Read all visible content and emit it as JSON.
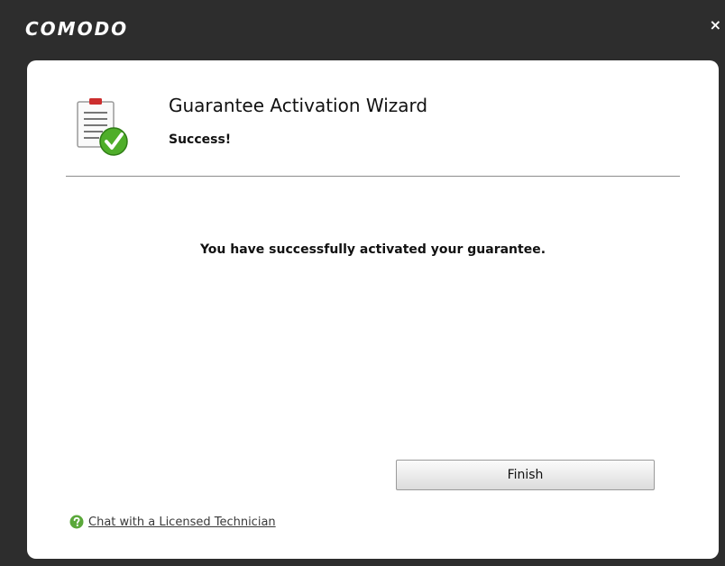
{
  "window": {
    "brand": "COMODO",
    "close_label": "×"
  },
  "header": {
    "title": "Guarantee Activation Wizard",
    "subtitle": "Success!",
    "icon": "document-check-icon"
  },
  "main": {
    "message": "You have successfully activated your guarantee."
  },
  "footer": {
    "finish_label": "Finish",
    "help_link": "Chat with a Licensed Technician",
    "help_icon": "question-icon"
  },
  "colors": {
    "frame": "#2d2d2d",
    "panel": "#ffffff",
    "check_green": "#4fae2a"
  }
}
